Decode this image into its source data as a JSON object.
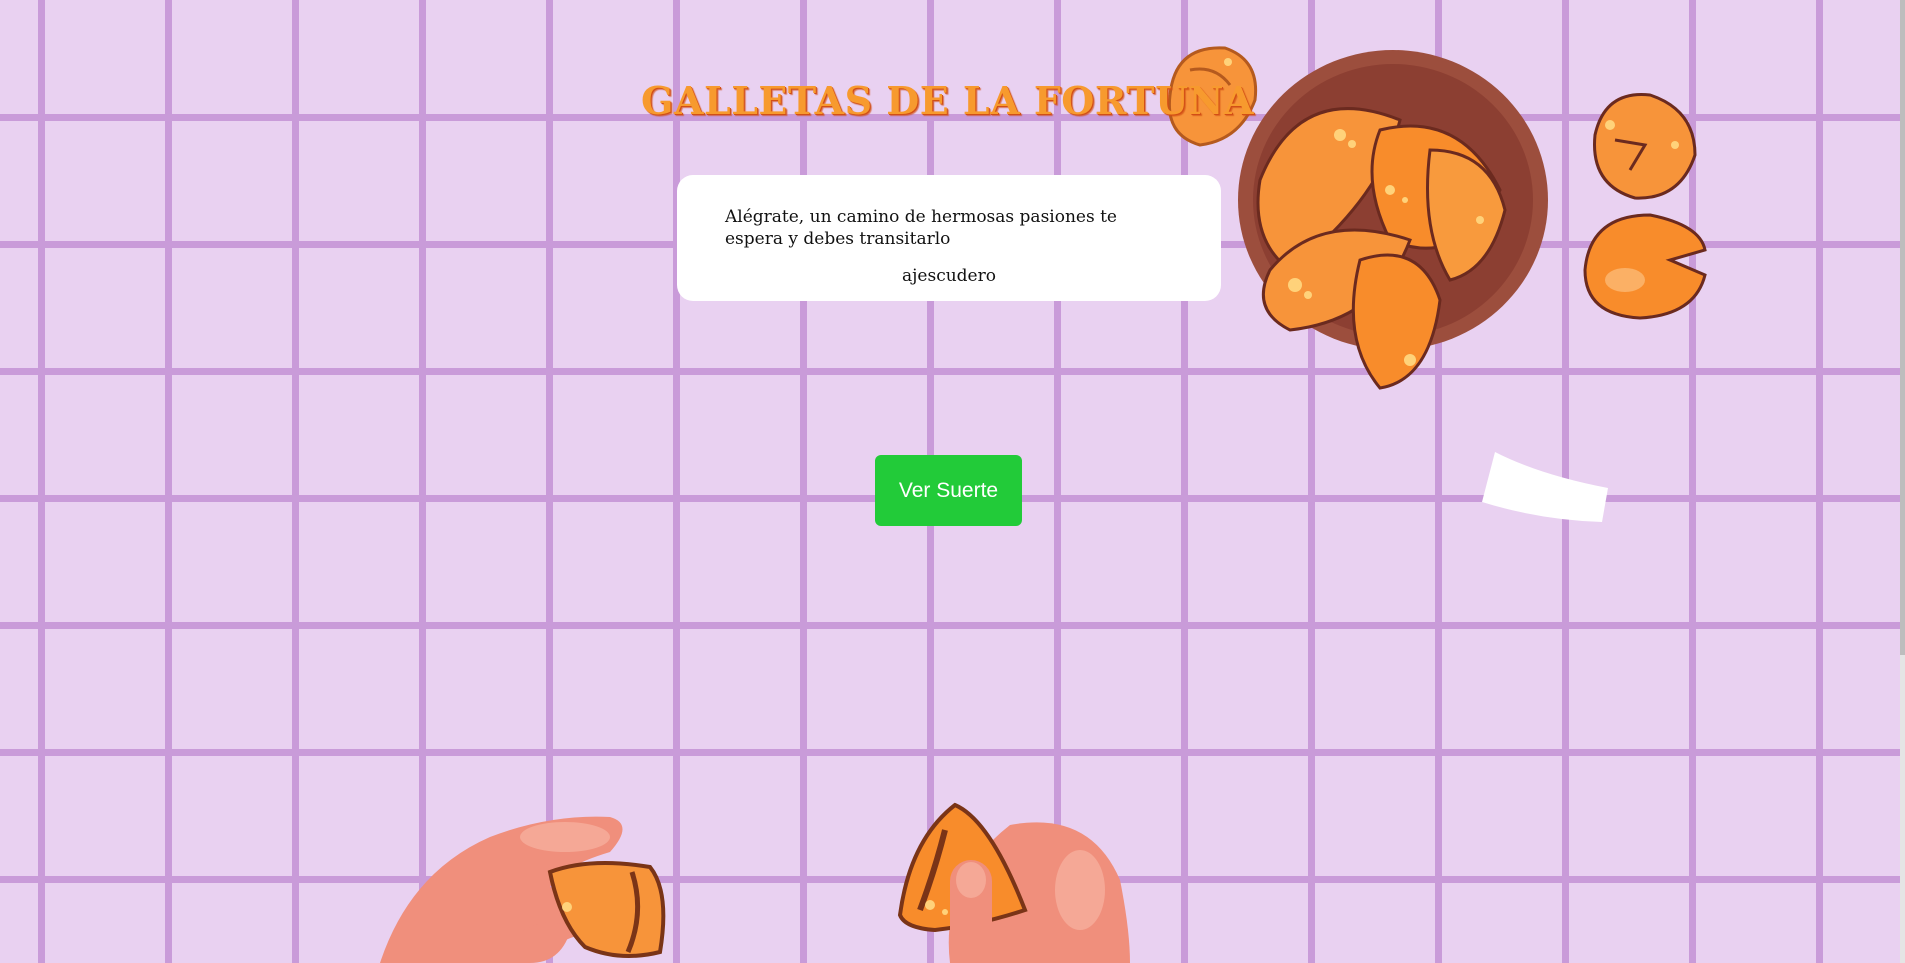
{
  "page": {
    "title": "GALLETAS DE LA FORTUNA"
  },
  "fortune": {
    "message": "Alégrate, un camino de hermosas pasiones te espera y debes transitarlo",
    "author": "ajescudero"
  },
  "actions": {
    "reveal_label": "Ver Suerte"
  },
  "colors": {
    "background": "#e9d1f1",
    "grid_lines": "#c99bd9",
    "title": "#f79a2e",
    "title_shadow": "#d24e16",
    "button": "#22cb39",
    "cookie": "#f78f2c",
    "bowl": "#a0503f",
    "hand": "#f08f7c"
  },
  "illustrations": {
    "bowl": "bowl-of-fortune-cookies-illustration",
    "cookie": "fortune-cookie-illustration",
    "paper": "fortune-paper-slip-illustration",
    "hands": "hand-holding-cookie-illustration"
  }
}
